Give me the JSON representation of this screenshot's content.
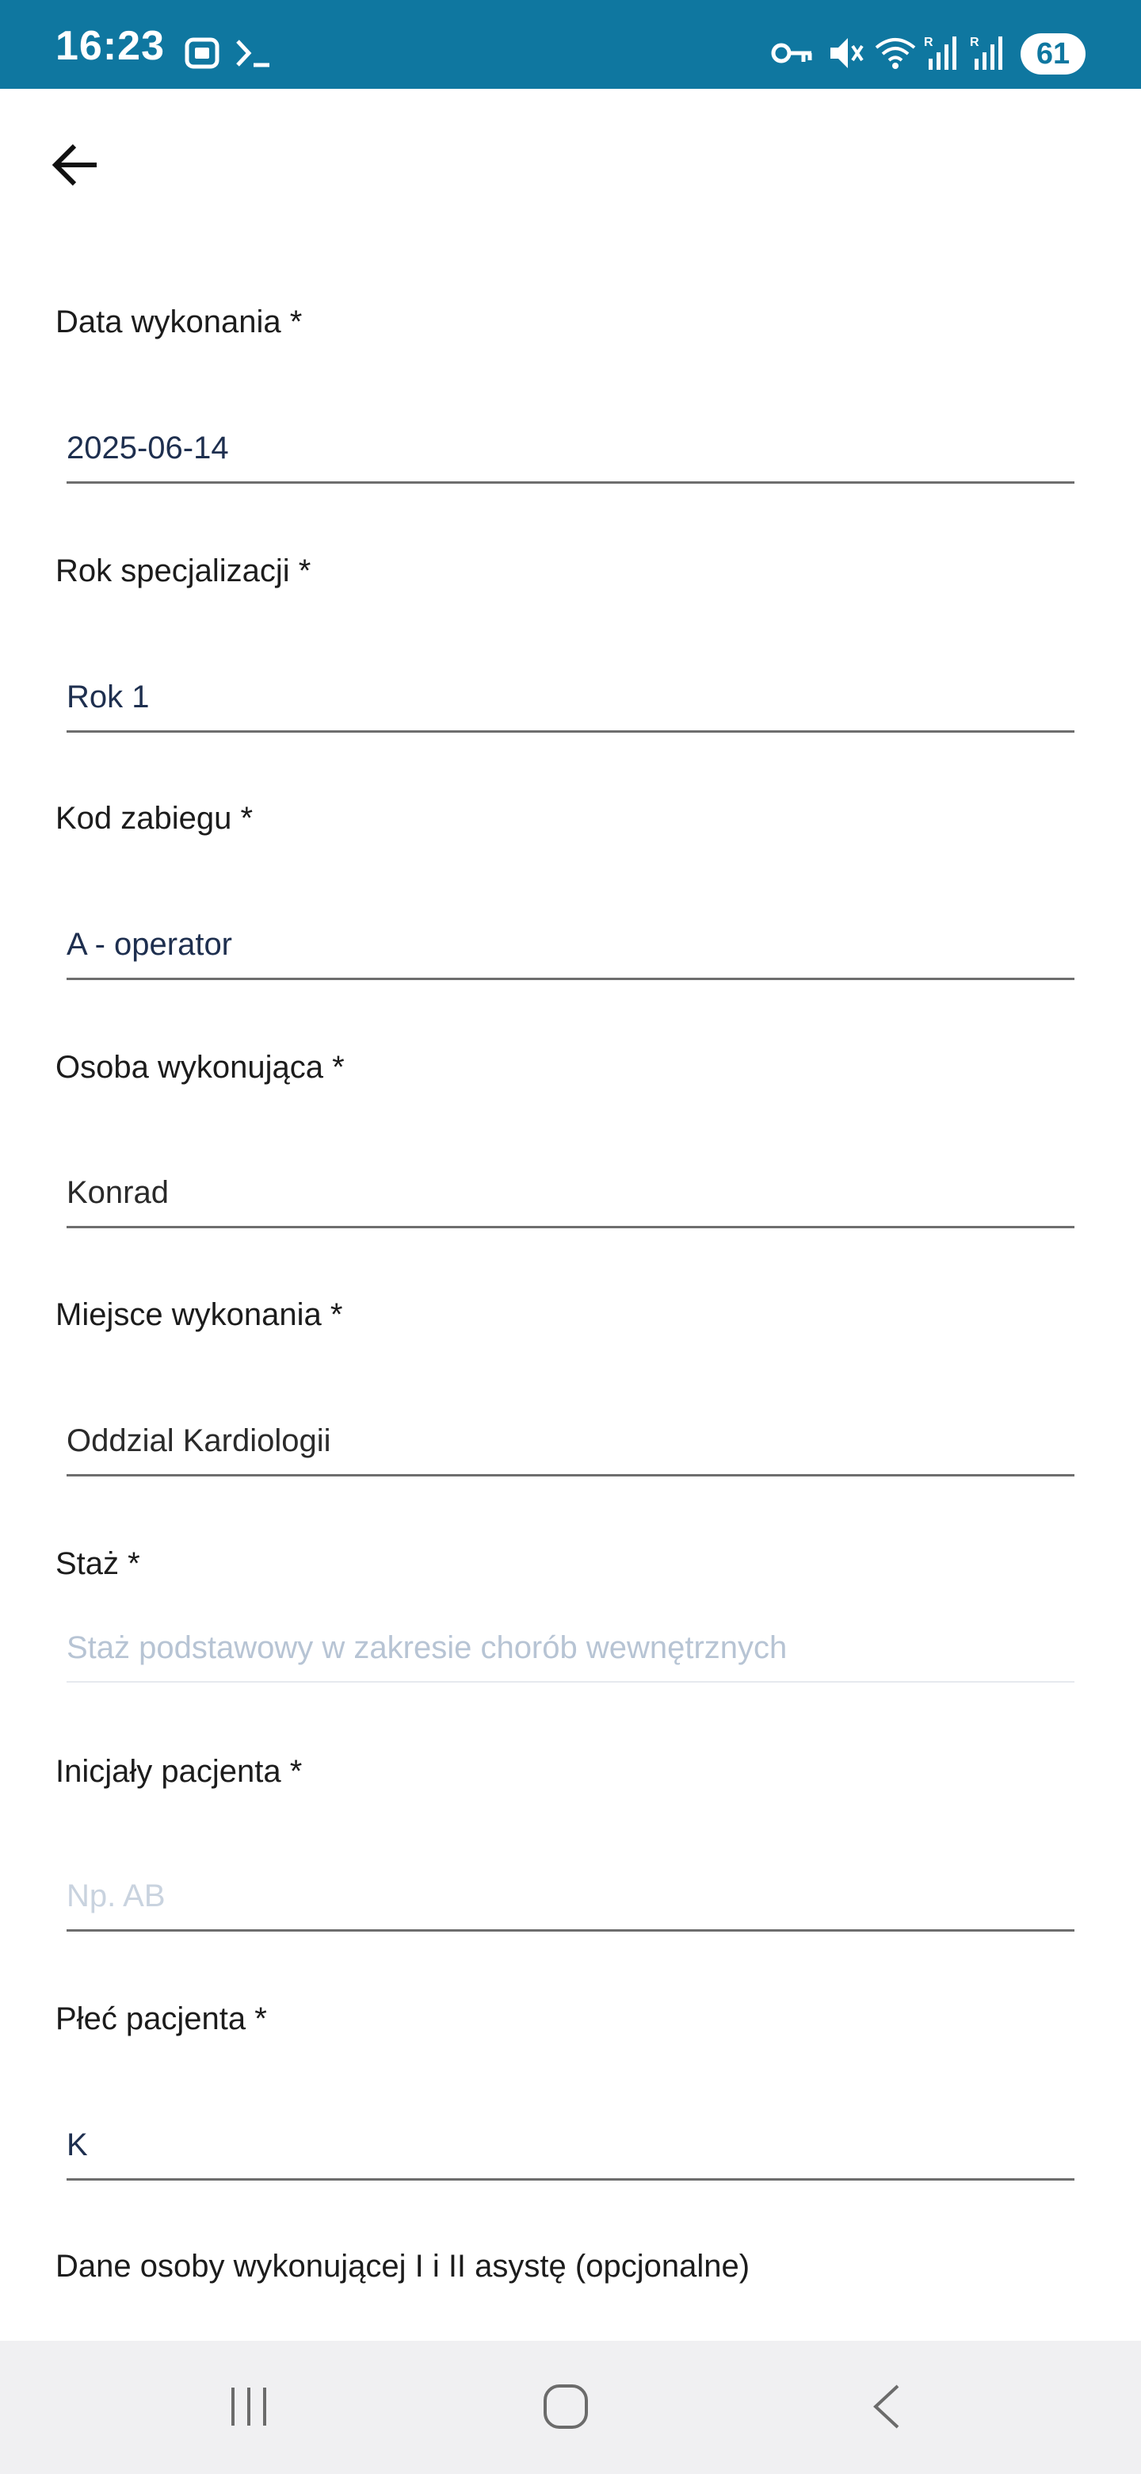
{
  "status_bar": {
    "time": "16:23",
    "battery": "61",
    "icons": [
      "screenshot-icon",
      "terminal-icon",
      "vpn-key-icon",
      "mute-icon",
      "wifi-icon",
      "signal-r-icon",
      "signal-r-icon"
    ]
  },
  "header": {
    "back_icon": "arrow-left-icon"
  },
  "form": {
    "date": {
      "label": "Data wykonania *",
      "value": "2025-06-14"
    },
    "year": {
      "label": "Rok specjalizacji *",
      "value": "Rok 1"
    },
    "code": {
      "label": "Kod zabiegu *",
      "value": "A - operator"
    },
    "performer": {
      "label": "Osoba wykonująca *",
      "value": "Konrad"
    },
    "place": {
      "label": "Miejsce wykonania *",
      "value": "Oddzial Kardiologii"
    },
    "internship": {
      "label": "Staż *",
      "value": "Staż podstawowy w zakresie chorób wewnętrznych"
    },
    "initials": {
      "label": "Inicjały pacjenta *",
      "placeholder": "Np. AB"
    },
    "sex": {
      "label": "Płeć pacjenta *",
      "value": "K"
    },
    "assistants_section": "Dane osoby wykonującej I i II asystę (opcjonalne)"
  },
  "nav_bar": {
    "icons": [
      "recent-apps-icon",
      "home-icon",
      "back-icon"
    ]
  },
  "colors": {
    "status_bar": "#0f77a0",
    "value_text": "#1e2f4f",
    "underline": "#6e6e6e",
    "muted_text": "#b7c4d4",
    "nav_bar": "#f0f0f2"
  }
}
